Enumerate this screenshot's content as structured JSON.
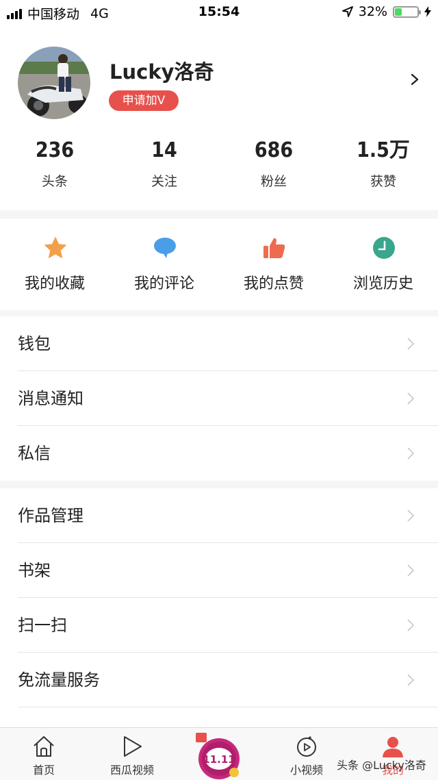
{
  "status_bar": {
    "carrier": "中国移动",
    "network": "4G",
    "time": "15:54",
    "battery_percent": "32%",
    "battery_level": 0.32
  },
  "profile": {
    "username": "Lucky洛奇",
    "apply_v_label": "申请加V",
    "avatar": "avatar-photo-rider-on-motorcycle"
  },
  "stats": [
    {
      "value": "236",
      "label": "头条"
    },
    {
      "value": "14",
      "label": "关注"
    },
    {
      "value": "686",
      "label": "粉丝"
    },
    {
      "value": "1.5万",
      "label": "获赞"
    }
  ],
  "quick_actions": [
    {
      "label": "我的收藏",
      "icon": "star-icon",
      "color": "#f4a04a"
    },
    {
      "label": "我的评论",
      "icon": "comment-bubble-icon",
      "color": "#4a9ee8"
    },
    {
      "label": "我的点赞",
      "icon": "thumbs-up-icon",
      "color": "#ee6b4f"
    },
    {
      "label": "浏览历史",
      "icon": "clock-icon",
      "color": "#3aa68e"
    }
  ],
  "menu_group_1": [
    "钱包",
    "消息通知",
    "私信"
  ],
  "menu_group_2": [
    "作品管理",
    "书架",
    "扫一扫",
    "免流量服务"
  ],
  "tabbar": {
    "home": "首页",
    "xigua": "西瓜视频",
    "festival_icon": "double-eleven-festival-icon",
    "short_video": "小视频",
    "me": "我的"
  },
  "watermark": "头条 @Lucky洛奇",
  "colors": {
    "accent": "#e8504b",
    "separator_bg": "#f4f5f6",
    "me_tab": "#e8504b"
  }
}
